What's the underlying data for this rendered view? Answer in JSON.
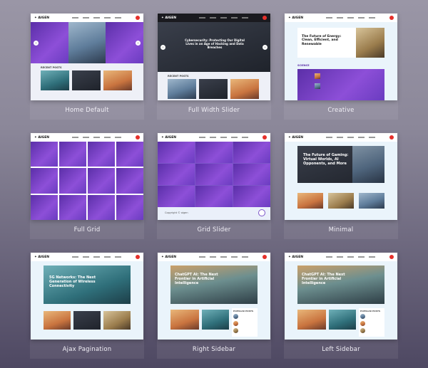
{
  "logo_text": "✦ AIGEN",
  "colors": {
    "accent": "#e5302b",
    "purple": "#6a3cc0"
  },
  "demos": [
    {
      "label": "Home Default",
      "section": "RECENT POSTS"
    },
    {
      "label": "Full Width Slider",
      "hero": "Cybersecurity: Protecting Our Digital Lives in an Age of Hacking and Data Breaches",
      "section": "RECENT POSTS"
    },
    {
      "label": "Creative",
      "hero": "The Future of Energy: Clean, Efficient, and Renewable",
      "section": "SCIENCE"
    },
    {
      "label": "Full Grid"
    },
    {
      "label": "Grid Slider",
      "footer": "Copyright © aigen"
    },
    {
      "label": "Minimal",
      "hero": "The Future of Gaming: Virtual Worlds, AI Opponents, and More"
    },
    {
      "label": "Ajax Pagination",
      "hero": "5G Networks: The Next Generation of Wireless Connectivity"
    },
    {
      "label": "Right Sidebar",
      "hero": "ChatGPT AI: The Next Frontier in Artificial Intelligence",
      "side": "POPULAR POSTS"
    },
    {
      "label": "Left Sidebar",
      "hero": "ChatGPT AI: The Next Frontier in Artificial Intelligence",
      "side": "POPULAR POSTS"
    }
  ]
}
